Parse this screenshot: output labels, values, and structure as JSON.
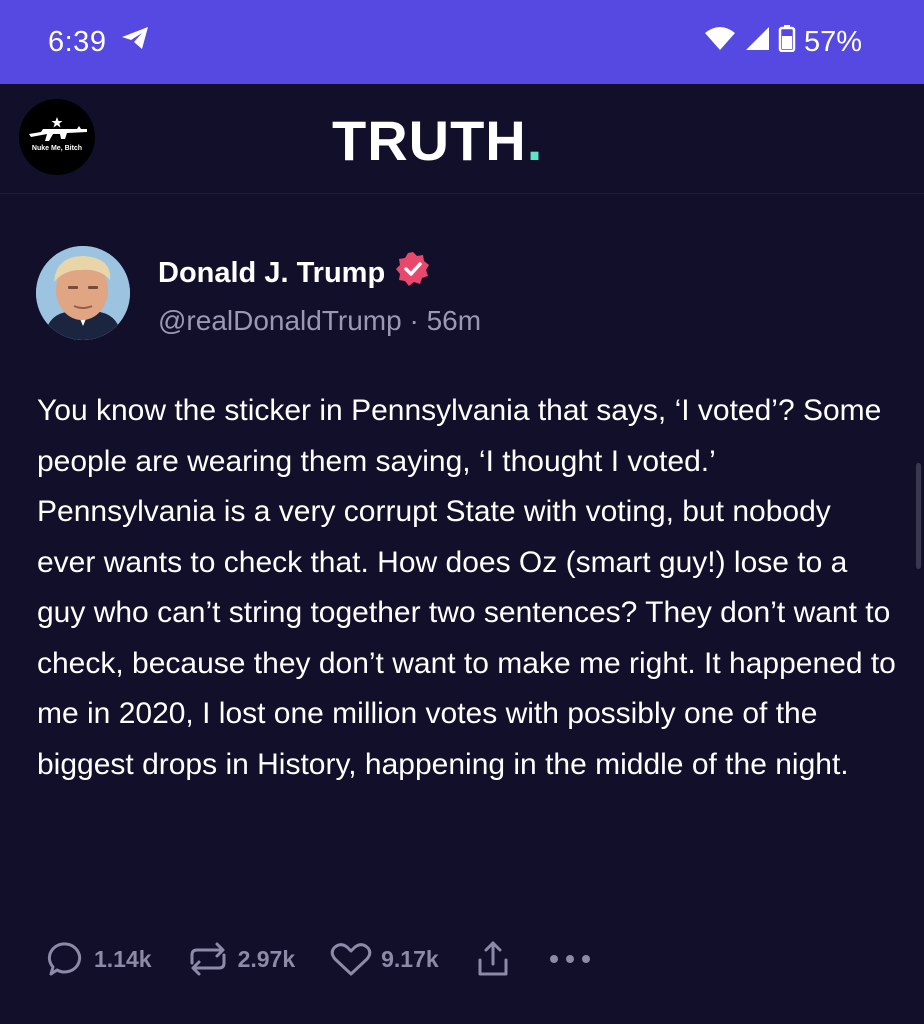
{
  "status_bar": {
    "time": "6:39",
    "battery_pct": "57%",
    "icons": [
      "telegram-icon",
      "wifi-icon",
      "signal-icon",
      "battery-icon"
    ]
  },
  "header": {
    "logo_text": "TRUTH",
    "logo_dot": ".",
    "avatar_caption": "Nuke Me, Bitch"
  },
  "post": {
    "author_name": "Donald J. Trump",
    "handle": "@realDonaldTrump",
    "separator": "·",
    "time_ago": "56m",
    "body": "You know the sticker in Pennsylvania that says, ‘I voted’? Some people are wearing them saying, ‘I thought I voted.’ Pennsylvania is a very corrupt State with voting, but nobody ever wants to check that. How does Oz (smart guy!) lose to a guy who can’t string together two sentences? They don’t want to check, because they don’t want to make me right. It happened to me in 2020, I lost one million votes with possibly one of the biggest drops in History, happening in the middle of the night.",
    "actions": {
      "replies": "1.14k",
      "retruths": "2.97k",
      "likes": "9.17k"
    }
  },
  "colors": {
    "status_bar": "#5549e2",
    "background": "#110f2a",
    "logo_accent": "#5ce5c8",
    "verified_badge": "#e8486b",
    "muted_text": "#9a98b3"
  }
}
